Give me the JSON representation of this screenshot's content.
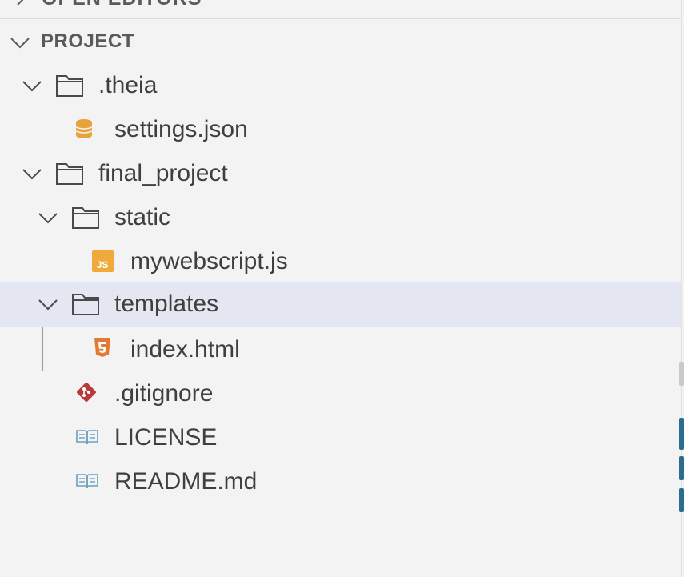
{
  "explorer": {
    "open_editors_label": "OPEN EDITORS",
    "section_title": "PROJECT",
    "items": [
      {
        "label": ".theia",
        "type": "folder",
        "expanded": true,
        "icon": "folder-icon"
      },
      {
        "label": "settings.json",
        "type": "file",
        "icon": "json-settings-icon"
      },
      {
        "label": "final_project",
        "type": "folder",
        "expanded": true,
        "icon": "folder-icon"
      },
      {
        "label": "static",
        "type": "folder",
        "expanded": true,
        "icon": "folder-icon"
      },
      {
        "label": "mywebscript.js",
        "type": "file",
        "icon": "javascript-file-icon"
      },
      {
        "label": "templates",
        "type": "folder",
        "expanded": true,
        "selected": true,
        "icon": "folder-icon"
      },
      {
        "label": "index.html",
        "type": "file",
        "icon": "html5-file-icon"
      },
      {
        "label": ".gitignore",
        "type": "file",
        "icon": "git-icon"
      },
      {
        "label": "LICENSE",
        "type": "file",
        "icon": "book-icon"
      },
      {
        "label": "README.md",
        "type": "file",
        "icon": "book-icon"
      }
    ]
  },
  "colors": {
    "background": "#f3f3f3",
    "selection": "#e4e6f1",
    "json_icon": "#e8a33d",
    "js_icon": "#f0a93b",
    "html_icon": "#e37933",
    "git_icon": "#b83a3a",
    "book_icon": "#6a9fbf"
  }
}
